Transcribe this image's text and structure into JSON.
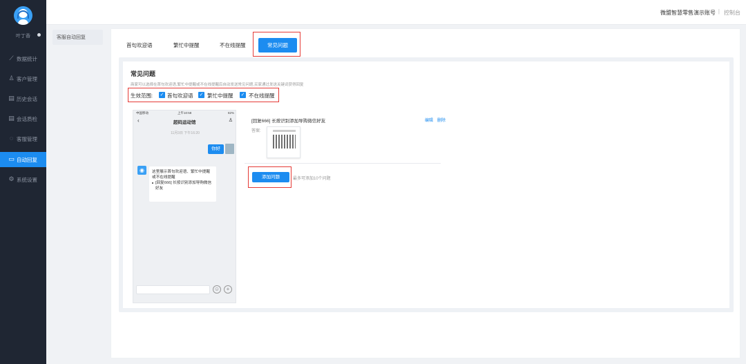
{
  "sidebar": {
    "user_name": "叶丁香",
    "items": [
      {
        "label": "数据统计",
        "icon": "chart-line-icon"
      },
      {
        "label": "客户管理",
        "icon": "user-icon"
      },
      {
        "label": "历史会话",
        "icon": "document-icon"
      },
      {
        "label": "会话质检",
        "icon": "document-check-icon"
      },
      {
        "label": "客服管理",
        "icon": "headset-icon"
      },
      {
        "label": "自动回复",
        "icon": "chat-icon"
      },
      {
        "label": "系统设置",
        "icon": "gear-icon"
      }
    ],
    "active_index": 5
  },
  "header": {
    "account": "微盟智慧零售演示账号",
    "separator": "|",
    "console": "控制台"
  },
  "submenu": {
    "label": "客服自动回复"
  },
  "tabs": [
    {
      "label": "首句欢迎语"
    },
    {
      "label": "繁忙中提醒"
    },
    {
      "label": "不在线提醒"
    },
    {
      "label": "常见问题"
    }
  ],
  "faq": {
    "title": "常见问题",
    "description": "商家可以选择在首句欢迎语,繁忙中提醒或不在线提醒后自动发送常见问题,买家通过发送关键词获得回复",
    "scope_label": "生效范围:",
    "scope_options": [
      "首句欢迎语",
      "繁忙中提醒",
      "不在线提醒"
    ]
  },
  "phone": {
    "carrier": "中国移动",
    "time_status": "上午10:58",
    "battery": "82%",
    "chat_title": "超码运动馆",
    "timestamp": "11月3日 下午16:20",
    "user_message": "你好",
    "bot_message_line1": "这里展示首句欢迎语、繁忙中提醒或不在线提醒",
    "bot_message_line2": "[回复666] 长按识别添加导购微信好友"
  },
  "question": {
    "text": "[回复666] 长按识别添加导购微信好友",
    "edit": "编辑",
    "delete": "删除",
    "answer_label": "答案:"
  },
  "add_button": "添加问题",
  "add_hint": "最多可添加10个问题",
  "colors": {
    "accent": "#1c8cf0",
    "sidebar": "#1f2633",
    "highlight": "#e53935"
  }
}
